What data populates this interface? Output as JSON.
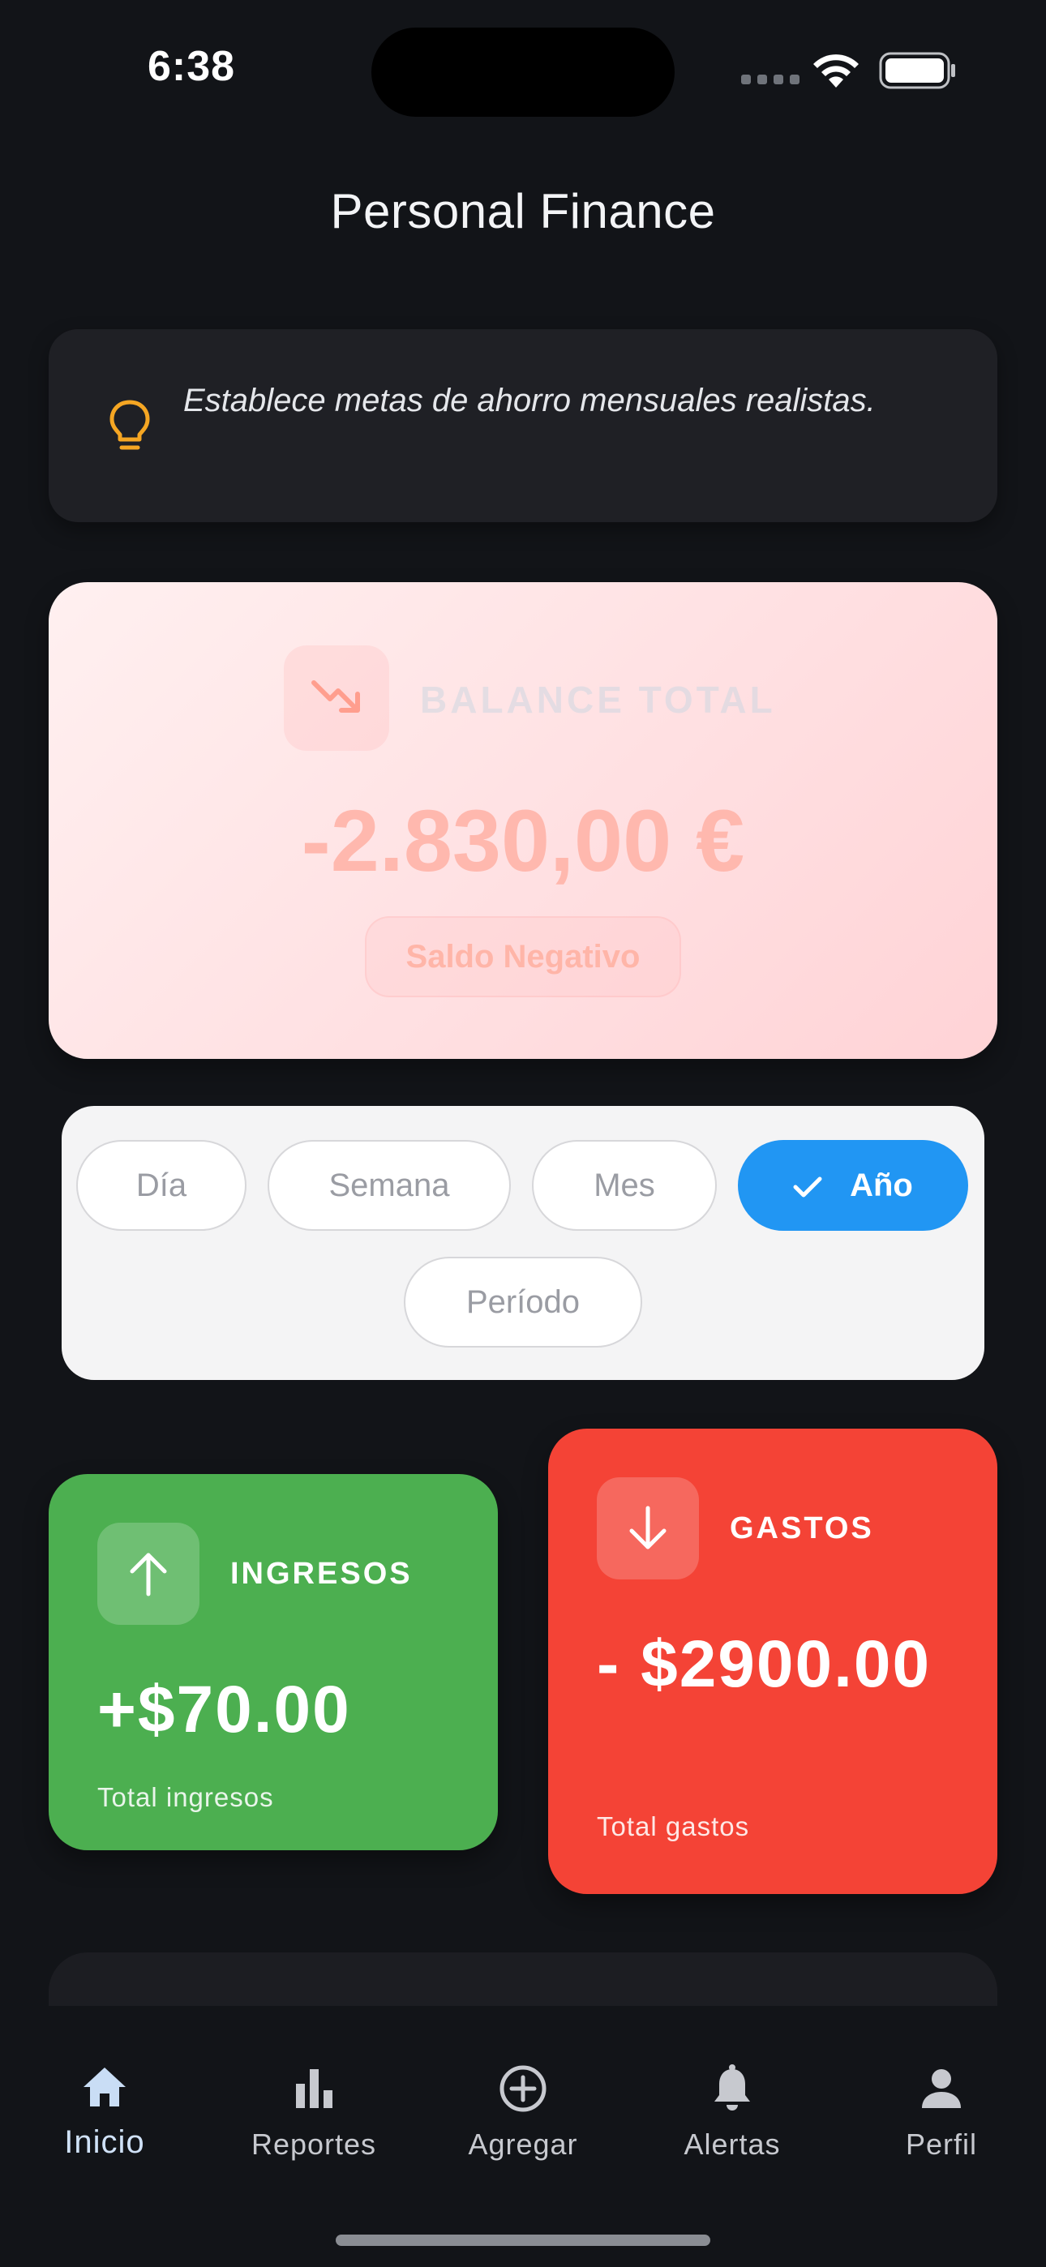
{
  "status_bar": {
    "time": "6:38"
  },
  "header": {
    "title": "Personal Finance"
  },
  "tip": {
    "text": "Establece metas de ahorro mensuales realistas.",
    "icon": "lightbulb-icon",
    "icon_color": "#f5a623"
  },
  "balance": {
    "label": "BALANCE TOTAL",
    "amount": "-2.830,00 €",
    "status": "Saldo Negativo",
    "icon": "trending-down-icon"
  },
  "period_selector": {
    "options": [
      "Día",
      "Semana",
      "Mes",
      "Año",
      "Período"
    ],
    "selected": "Año",
    "accent": "#2196f3"
  },
  "income": {
    "label": "INGRESOS",
    "amount": "+$70.00",
    "subtitle": "Total ingresos",
    "icon": "arrow-up-icon",
    "color": "#4caf50"
  },
  "expenses": {
    "label": "GASTOS",
    "amount": "- $2900.00",
    "subtitle": "Total gastos",
    "icon": "arrow-down-icon",
    "color": "#f44336"
  },
  "bottom_nav": {
    "items": [
      {
        "label": "Inicio",
        "icon": "home-icon",
        "active": true
      },
      {
        "label": "Reportes",
        "icon": "bar-chart-icon",
        "active": false
      },
      {
        "label": "Agregar",
        "icon": "add-circle-icon",
        "active": false
      },
      {
        "label": "Alertas",
        "icon": "bell-icon",
        "active": false
      },
      {
        "label": "Perfil",
        "icon": "person-icon",
        "active": false
      }
    ]
  }
}
